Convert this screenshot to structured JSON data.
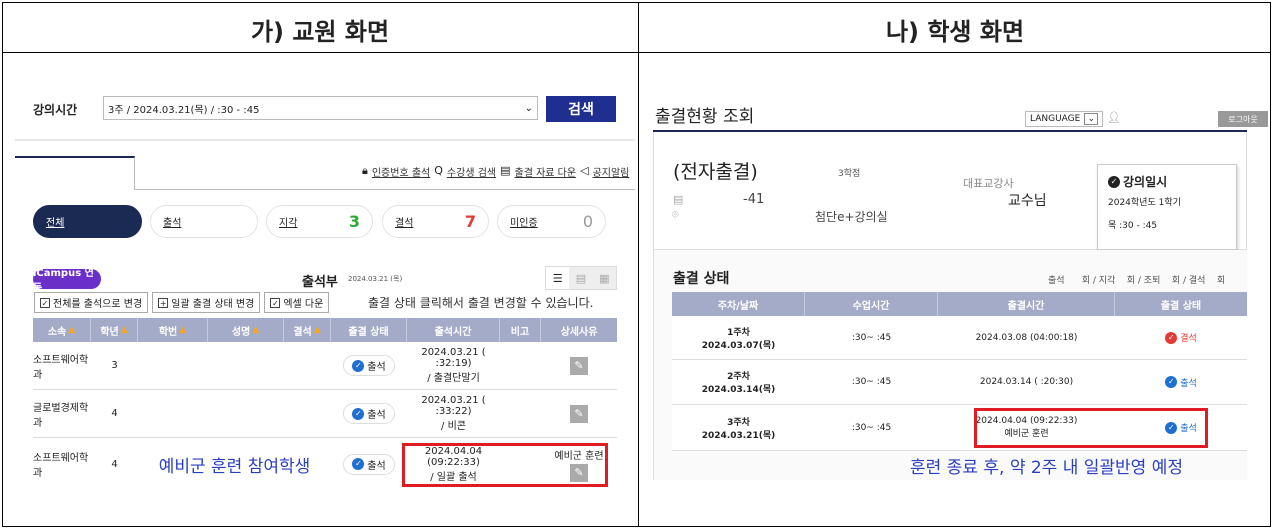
{
  "panels": {
    "left_title": "가) 교원 화면",
    "right_title": "나) 학생 화면"
  },
  "teacher": {
    "search": {
      "label": "강의시간",
      "value": "3주 / 2024.03.21(목) /     :30 -     :45",
      "button": "검색"
    },
    "toolbar": [
      "인증번호 출석",
      "수강생 검색",
      "출결 자료 다운",
      "공지알림"
    ],
    "filters": [
      {
        "label": "전체",
        "count": ""
      },
      {
        "label": "출석",
        "count": ""
      },
      {
        "label": "지각",
        "count": "3"
      },
      {
        "label": "결석",
        "count": "7"
      },
      {
        "label": "미인증",
        "count": "0"
      }
    ],
    "colors": {
      "active_pill": "#1b2a52",
      "late": "#2eaa3a",
      "absent": "#e53935",
      "zero": "#999999",
      "icampus": "#6a2fc9",
      "header": "#a4abc9",
      "highlight": "#e01b24"
    },
    "icampus": "iCampus 연동",
    "sheet_title": "출석부",
    "sheet_date": "2024.03.21 (목)",
    "actions": [
      "전체를 출석으로 변경",
      "일괄 출결 상태 변경",
      "엑셀 다운"
    ],
    "hint": "출결 상태 클릭해서 출결 변경할 수 있습니다.",
    "columns": [
      "소속",
      "학년",
      "학번",
      "성명",
      "결석",
      "출결 상태",
      "출석시간",
      "비고",
      "상세사유"
    ],
    "rows": [
      {
        "dept": "소프트웨어학과",
        "grade": "3",
        "status": "출석",
        "time": "2024.03.21 (    :32:19)",
        "method": "/ 출결단말기",
        "reason": ""
      },
      {
        "dept": "글로벌경제학과",
        "grade": "4",
        "status": "출석",
        "time": "2024.03.21 (    :33:22)",
        "method": "/ 비콘",
        "reason": ""
      },
      {
        "dept": "소프트웨어학과",
        "grade": "4",
        "status": "출석",
        "time": "2024.04.04 (09:22:33)",
        "method": "/ 일괄 출석",
        "reason": "예비군 훈련"
      }
    ],
    "annotation": "예비군 훈련 참여학생"
  },
  "student": {
    "title": "출결현황 조회",
    "language": "LANGUAGE",
    "logout": "로그아웃",
    "course": {
      "name": "(전자출결)",
      "credits": "3학점",
      "code": "-41",
      "room": "첨단e+강의실",
      "instructor_label": "대표교강사",
      "instructor": "교수님"
    },
    "schedule": {
      "title": "강의일시",
      "term": "2024학년도 1학기",
      "time": "목     :30 -     :45"
    },
    "section": "출결 상태",
    "summary": "출석      회 / 지각    회 / 조퇴    회 / 결석    회",
    "columns": [
      "주차/날짜",
      "수업시간",
      "출결시간",
      "출결 상태"
    ],
    "rows": [
      {
        "week": "1주차",
        "date": "2024.03.07(목)",
        "class_time": ":30~    :45",
        "time": "2024.03.08 (04:00:18)",
        "note": "",
        "status": "결석"
      },
      {
        "week": "2주차",
        "date": "2024.03.14(목)",
        "class_time": ":30~    :45",
        "time": "2024.03.14 (    :20:30)",
        "note": "",
        "status": "출석"
      },
      {
        "week": "3주차",
        "date": "2024.03.21(목)",
        "class_time": ":30~    :45",
        "time": "2024.04.04 (09:22:33)",
        "note": "예비군 훈련",
        "status": "출석"
      }
    ],
    "annotation": "훈련 종료 후, 약 2주 내 일괄반영 예정"
  }
}
